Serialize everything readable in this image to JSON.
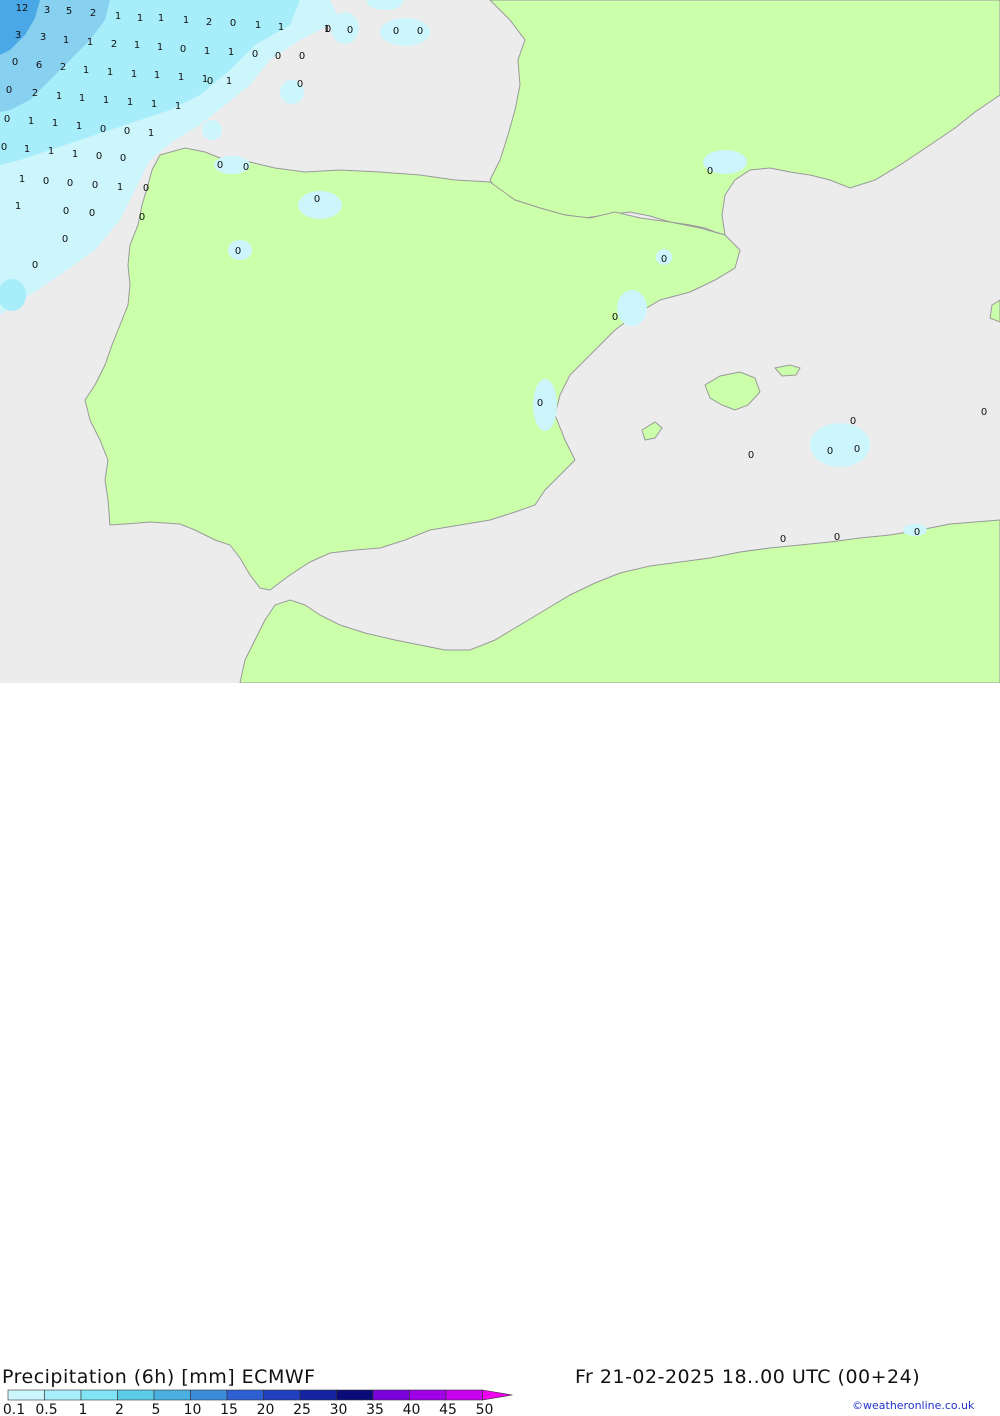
{
  "map": {
    "colors": {
      "sea": "#ececec",
      "land": "#ccffaa",
      "coast": "#999999",
      "precip_light": "#ccf6fc",
      "precip_mid": "#a8eefa",
      "precip_high": "#88d0f0",
      "precip_max": "#4aa8e6"
    },
    "values": [
      {
        "v": "12"
      },
      {
        "v": "3"
      },
      {
        "v": "5"
      },
      {
        "v": "2"
      },
      {
        "v": "1"
      },
      {
        "v": "1"
      },
      {
        "v": "1"
      },
      {
        "v": "1"
      },
      {
        "v": "2"
      },
      {
        "v": "0"
      },
      {
        "v": "1"
      },
      {
        "v": "1"
      },
      {
        "v": "0"
      },
      {
        "v": "0"
      },
      {
        "v": "0"
      },
      {
        "v": "0"
      },
      {
        "v": "0"
      },
      {
        "v": "3"
      },
      {
        "v": "3"
      },
      {
        "v": "1"
      },
      {
        "v": "1"
      },
      {
        "v": "2"
      },
      {
        "v": "1"
      },
      {
        "v": "1"
      },
      {
        "v": "0"
      },
      {
        "v": "1"
      },
      {
        "v": "1"
      },
      {
        "v": "0"
      },
      {
        "v": "0"
      },
      {
        "v": "0"
      },
      {
        "v": "6"
      },
      {
        "v": "2"
      },
      {
        "v": "1"
      },
      {
        "v": "1"
      },
      {
        "v": "1"
      },
      {
        "v": "1"
      },
      {
        "v": "1"
      },
      {
        "v": "1"
      },
      {
        "v": "1"
      },
      {
        "v": "0"
      },
      {
        "v": "1"
      },
      {
        "v": "0"
      },
      {
        "v": "2"
      },
      {
        "v": "1"
      },
      {
        "v": "1"
      },
      {
        "v": "1"
      },
      {
        "v": "1"
      },
      {
        "v": "1"
      },
      {
        "v": "1"
      },
      {
        "v": "0"
      },
      {
        "v": "0"
      },
      {
        "v": "1"
      },
      {
        "v": "1"
      },
      {
        "v": "1"
      },
      {
        "v": "0"
      },
      {
        "v": "0"
      },
      {
        "v": "1"
      },
      {
        "v": "0"
      },
      {
        "v": "1"
      },
      {
        "v": "1"
      },
      {
        "v": "1"
      },
      {
        "v": "0"
      },
      {
        "v": "0"
      },
      {
        "v": "0"
      },
      {
        "v": "1"
      },
      {
        "v": "0"
      },
      {
        "v": "0"
      },
      {
        "v": "0"
      },
      {
        "v": "1"
      },
      {
        "v": "1"
      },
      {
        "v": "0"
      },
      {
        "v": "0"
      },
      {
        "v": "0"
      },
      {
        "v": "0"
      },
      {
        "v": "0"
      },
      {
        "v": "0"
      },
      {
        "v": "0"
      },
      {
        "v": "0"
      },
      {
        "v": "0"
      },
      {
        "v": "0"
      },
      {
        "v": "0"
      },
      {
        "v": "0"
      },
      {
        "v": "0"
      },
      {
        "v": "0"
      },
      {
        "v": "0"
      },
      {
        "v": "0"
      },
      {
        "v": "0"
      },
      {
        "v": "0"
      },
      {
        "v": "0"
      },
      {
        "v": "0"
      },
      {
        "v": "0"
      },
      {
        "v": "0"
      },
      {
        "v": "0"
      },
      {
        "v": "0"
      }
    ]
  },
  "footer": {
    "title": "Precipitation (6h) [mm] ECMWF",
    "datetime": "Fr 21-02-2025 18..00 UTC (00+24)",
    "credit": "©weatheronline.co.uk"
  },
  "legend": {
    "colors": [
      "#ccf6fc",
      "#a8eefa",
      "#80e4f4",
      "#5ccce6",
      "#4ab0e0",
      "#3c8cdc",
      "#2e60d4",
      "#2040c0",
      "#1424a0",
      "#0a0a78",
      "#7a00dc",
      "#a000e6",
      "#c800f0",
      "#f000f0",
      "#d200c0",
      "#b000a0"
    ],
    "labels": [
      "0.1",
      "0.5",
      "1",
      "2",
      "5",
      "10",
      "15",
      "20",
      "25",
      "30",
      "35",
      "40",
      "45",
      "50"
    ]
  }
}
